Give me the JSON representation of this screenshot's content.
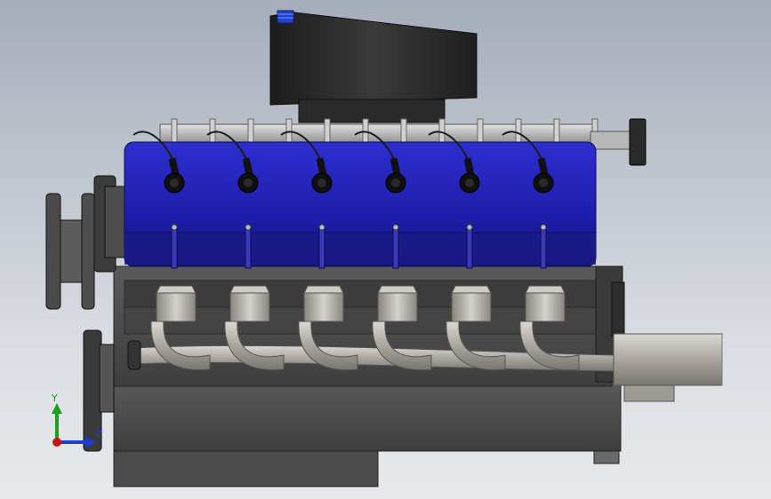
{
  "viewport": {
    "background_top": "#a5adba",
    "background_bottom": "#e7e9ec"
  },
  "model": {
    "valve_cover_color": "#1f1fa8",
    "block_color": "#4a4a4a",
    "intake_color": "#2a2a2a",
    "header_color": "#b9b4ad",
    "spark_plug_count": 6,
    "exhaust_port_count": 6
  },
  "triad": {
    "y_label": "Y",
    "z_label": "Z",
    "y_color": "#1aa01a",
    "z_color": "#1a3fd0",
    "x_color": "#cc1111"
  }
}
